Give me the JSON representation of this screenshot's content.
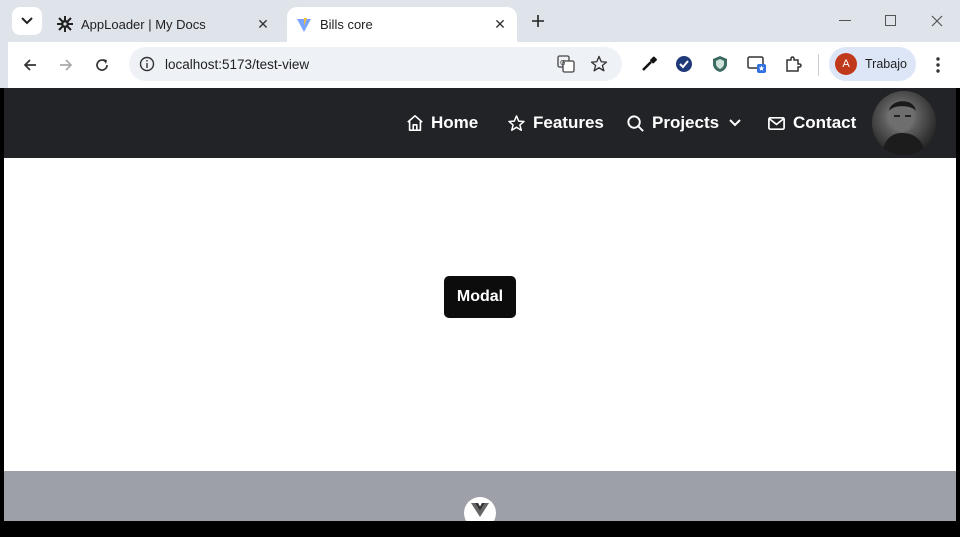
{
  "tabs": [
    {
      "title": "AppLoader | My Docs",
      "icon": "gear-icon",
      "active": false
    },
    {
      "title": "Bills core",
      "icon": "vite-logo-icon",
      "active": true
    }
  ],
  "address_bar": {
    "url": "localhost:5173/test-view"
  },
  "profile": {
    "initial": "A",
    "name": "Trabajo",
    "color": "#c1391b"
  },
  "site_nav": {
    "links": [
      {
        "label": "Home",
        "icon": "home-icon"
      },
      {
        "label": "Features",
        "icon": "star-icon"
      },
      {
        "label": "Projects",
        "icon": "search-icon",
        "dropdown": true
      },
      {
        "label": "Contact",
        "icon": "mail-icon"
      }
    ],
    "background": "#222327"
  },
  "main": {
    "modal_button_label": "Modal"
  },
  "colors": {
    "footer": "#9ea0a8",
    "chrome": "#dfe3ea",
    "omnibox": "#eef1f6"
  }
}
